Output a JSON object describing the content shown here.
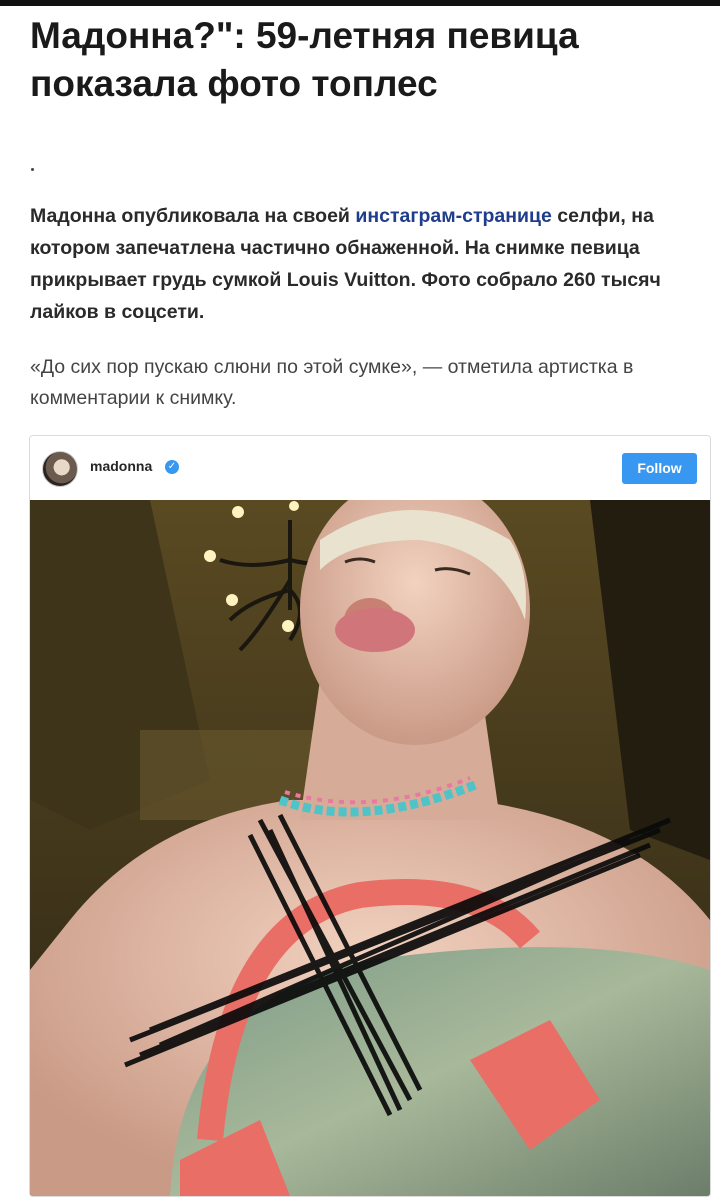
{
  "article": {
    "title": "Мадонна?\": 59-летняя певица показала фото топлес",
    "lead_before": "Мадонна опубликовала на своей ",
    "lead_link": "инстаграм-странице",
    "lead_after": " селфи, на котором запечатлена частично обнаженной. На снимке певица прикрывает грудь сумкой Louis Vuitton. Фото собрало 260 тысяч лайков в соцсети.",
    "quote": "«До сих пор пускаю слюни по этой сумке», — отметила артистка в комментарии к снимку."
  },
  "embed": {
    "username": "madonna",
    "follow_label": "Follow",
    "verified_icon": "verified-check-icon",
    "colors": {
      "follow": "#3897f0",
      "link": "#1f3d8c"
    }
  }
}
